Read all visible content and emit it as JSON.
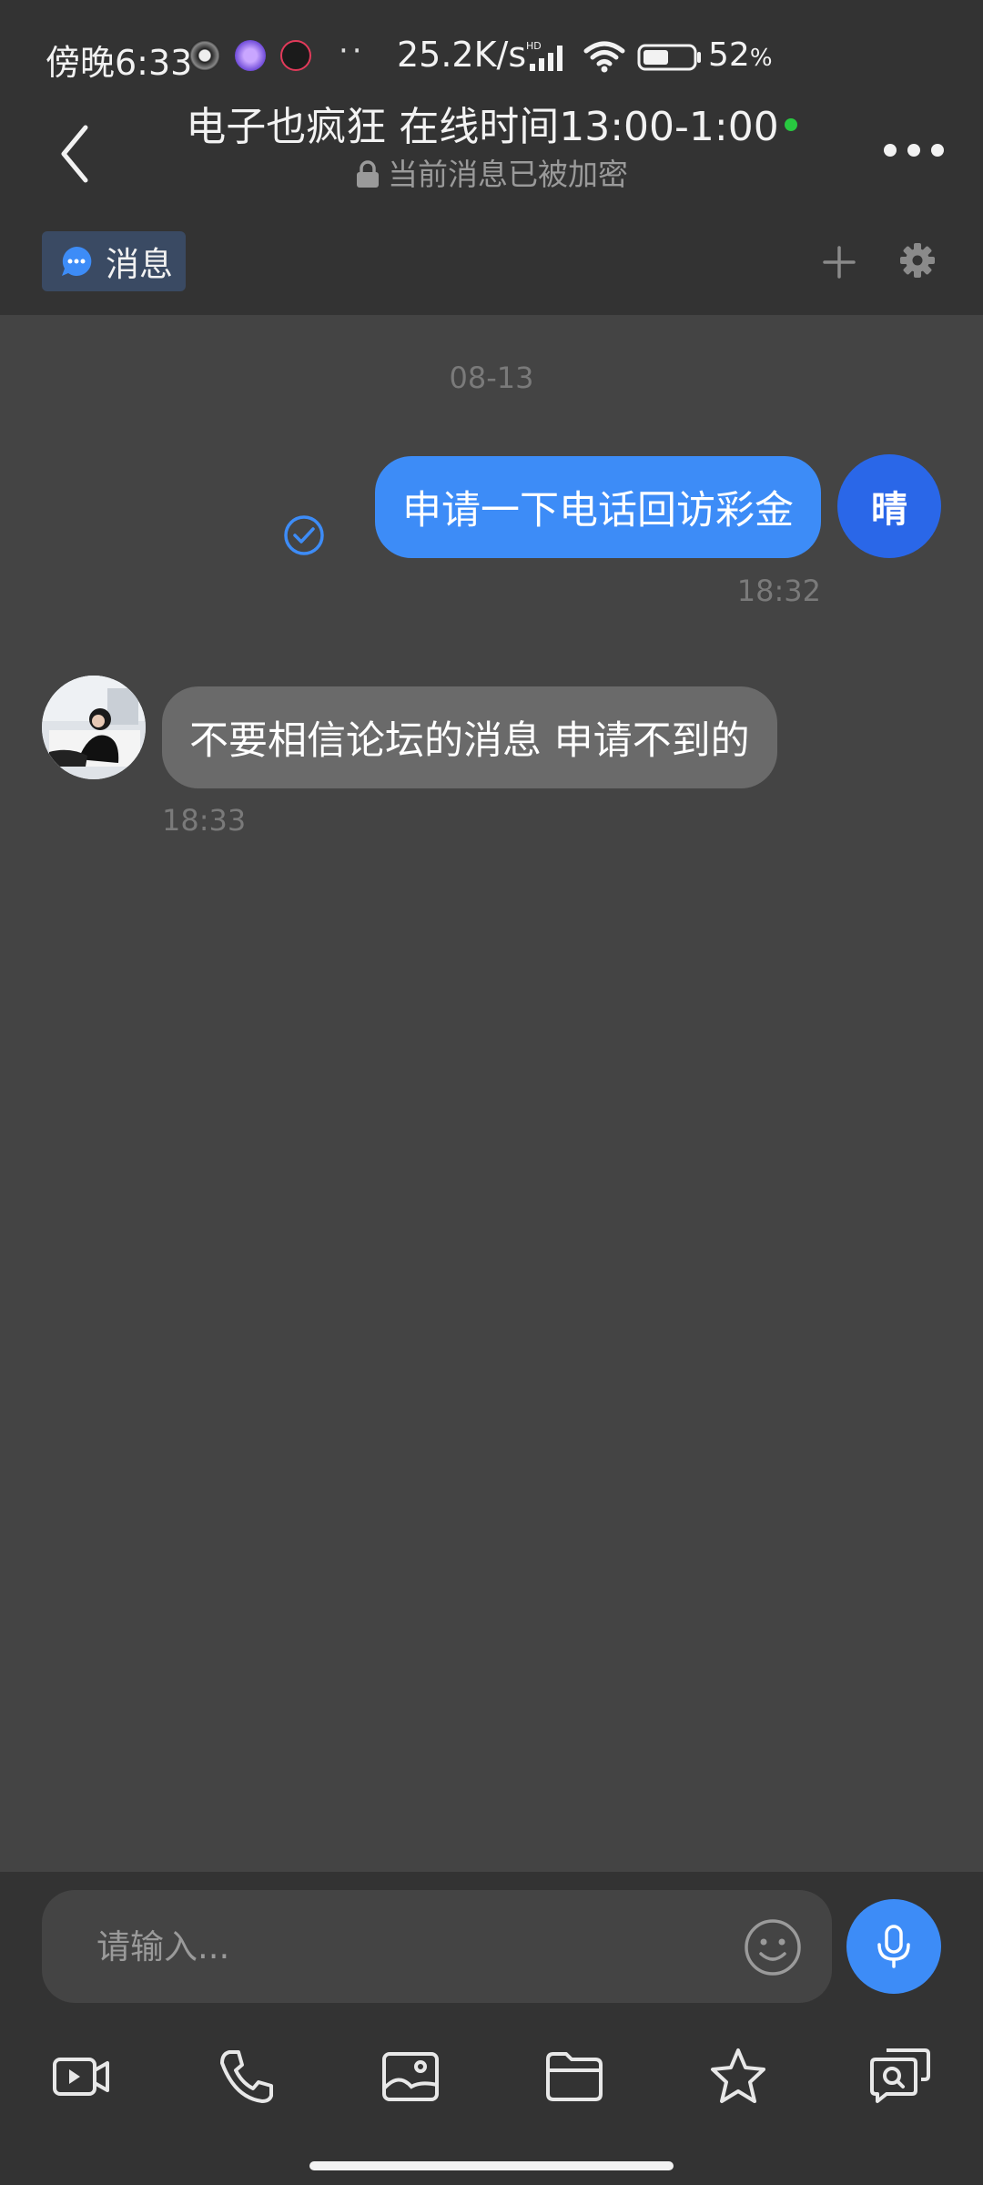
{
  "status_bar": {
    "time": "傍晚6:33",
    "more_dots": "··",
    "network_speed": "25.2K/s",
    "hd_label": "HD",
    "battery_percent": "52",
    "battery_unit": "%",
    "battery_level": 0.52
  },
  "header": {
    "title": "电子也疯狂  在线时间13:00-1:00",
    "subtitle": "当前消息已被加密",
    "online_status_color": "#28c840"
  },
  "tabs": {
    "messages_label": "消息"
  },
  "chat": {
    "date_separator": "08-13",
    "messages": [
      {
        "direction": "out",
        "text": "申请一下电话回访彩金",
        "time": "18:32",
        "avatar_text": "晴",
        "read": true
      },
      {
        "direction": "in",
        "text": "不要相信论坛的消息 申请不到的",
        "time": "18:33"
      }
    ]
  },
  "composer": {
    "placeholder": "请输入..."
  },
  "toolbar": {
    "icons": [
      "video-icon",
      "phone-icon",
      "image-icon",
      "folder-icon",
      "star-icon",
      "chat-search-icon"
    ]
  },
  "colors": {
    "accent": "#3d8cf7",
    "bubble_in": "#6a6a6a",
    "background": "#444444",
    "header_bg": "#333333"
  }
}
